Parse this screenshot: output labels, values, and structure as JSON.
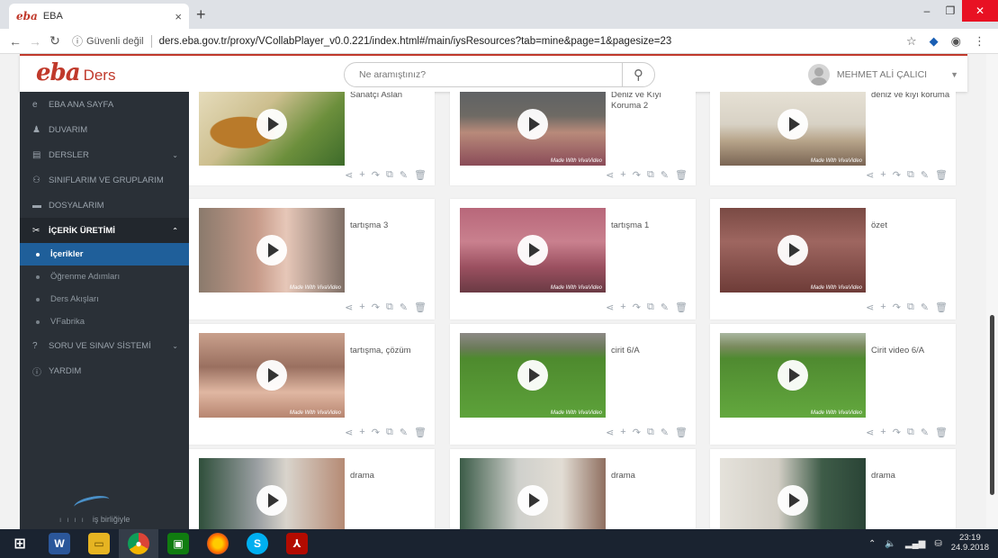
{
  "browser": {
    "tab_title": "EBA",
    "tab_favicon": "eba",
    "url": "ders.eba.gov.tr/proxy/VCollabPlayer_v0.0.221/index.html#/main/iysResources?tab=mine&page=1&pagesize=23",
    "security_label": "Güvenli değil"
  },
  "header": {
    "logo_text": "eba",
    "logo_sub": "Ders",
    "search_placeholder": "Ne aramıştınız?",
    "user_name": "MEHMET ALİ ÇALICI"
  },
  "sidebar": {
    "items": [
      {
        "label": "EBA ANA SAYFA",
        "icon": "eba-logo-icon"
      },
      {
        "label": "DUVARIM",
        "icon": "user-icon"
      },
      {
        "label": "DERSLER",
        "icon": "book-icon",
        "has_submenu": true
      },
      {
        "label": "SINIFLARIM VE GRUPLARIM",
        "icon": "group-icon"
      },
      {
        "label": "DOSYALARIM",
        "icon": "folder-icon"
      },
      {
        "label": "İÇERİK ÜRETİMİ",
        "icon": "tools-icon",
        "active": true,
        "has_submenu": true
      },
      {
        "label": "SORU VE SINAV SİSTEMİ",
        "icon": "quiz-icon",
        "has_submenu": true
      },
      {
        "label": "YARDIM",
        "icon": "info-icon"
      }
    ],
    "subitems": [
      {
        "label": "İçerikler",
        "active": true
      },
      {
        "label": "Öğrenme Adımları"
      },
      {
        "label": "Ders Akışları"
      },
      {
        "label": "VFabrika"
      }
    ],
    "partner_text": "iş birliğiyle"
  },
  "cards": [
    {
      "title": "Sanatçı Aslan",
      "scene": "s-lion"
    },
    {
      "title": "Deniz ve Kıyı Koruma 2",
      "scene": "s-class1"
    },
    {
      "title": "deniz ve kıyı koruma",
      "scene": "s-class2"
    },
    {
      "title": "tartışma 3",
      "scene": "s-class3"
    },
    {
      "title": "tartışma 1",
      "scene": "s-class4"
    },
    {
      "title": "özet",
      "scene": "s-class5"
    },
    {
      "title": "tartışma, çözüm",
      "scene": "s-class6"
    },
    {
      "title": "cirit 6/A",
      "scene": "s-field1"
    },
    {
      "title": "Cirit video 6/A",
      "scene": "s-field2"
    },
    {
      "title": "drama",
      "scene": "s-drama1"
    },
    {
      "title": "drama",
      "scene": "s-drama2"
    },
    {
      "title": "drama",
      "scene": "s-drama3"
    }
  ],
  "card_actions": [
    "share-icon",
    "add-icon",
    "forward-icon",
    "binoculars-icon",
    "edit-icon",
    "trash-icon"
  ],
  "watermark": "Made With VivaVideo",
  "taskbar": {
    "apps": [
      "windows-start-icon",
      "word-icon",
      "file-explorer-icon",
      "chrome-icon",
      "store-icon",
      "firefox-icon",
      "skype-icon",
      "acrobat-icon"
    ],
    "time": "23:19",
    "date": "24.9.2018"
  },
  "colors": {
    "brand": "#c0392b",
    "sidebar": "#2a3037",
    "active_sub": "#1f5f9a",
    "taskbar": "#1a2330"
  }
}
